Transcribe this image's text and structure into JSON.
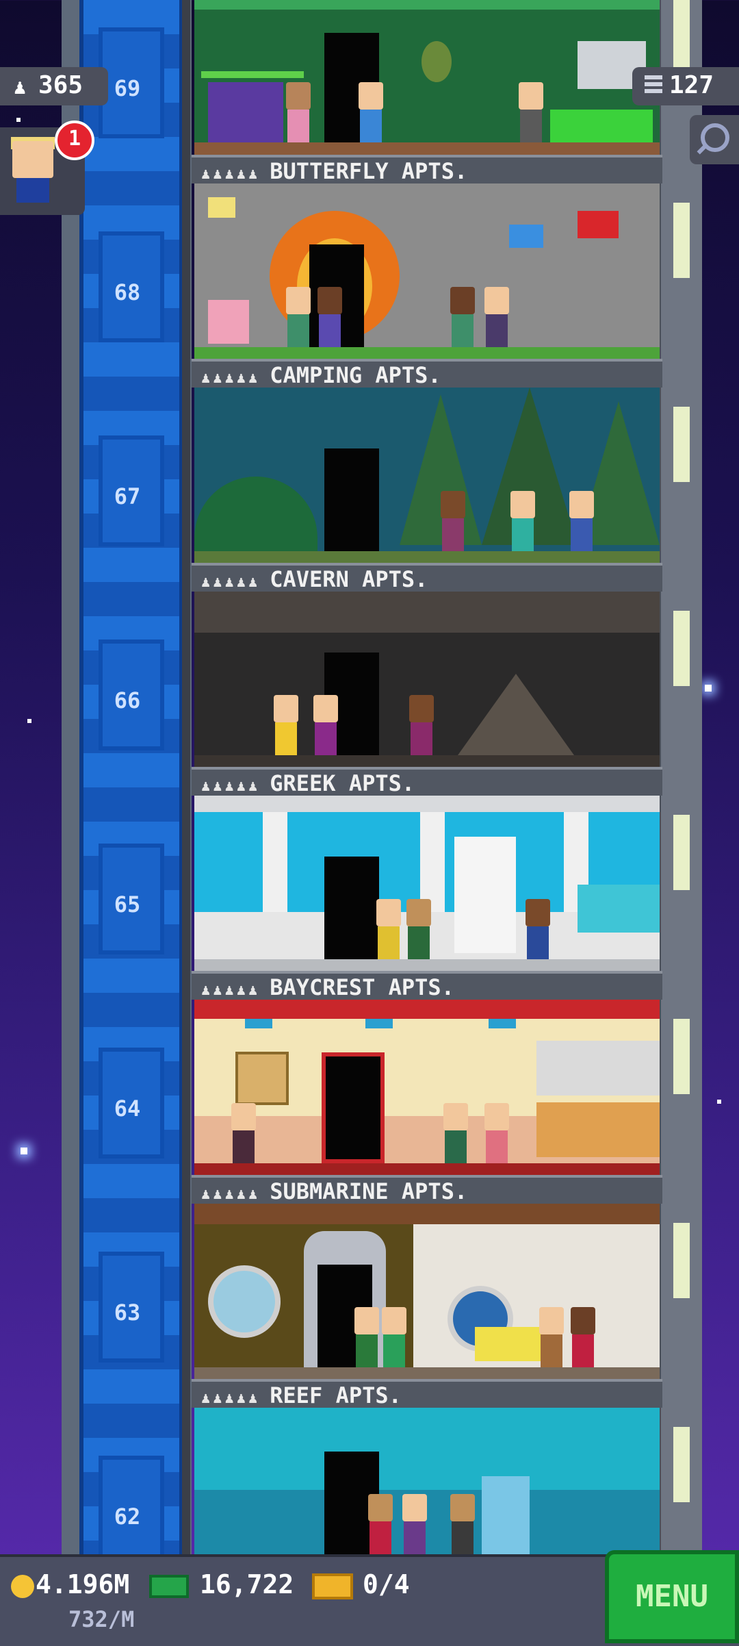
{
  "hud": {
    "population": "365",
    "floors": "127",
    "notification_count": "1"
  },
  "floors": [
    {
      "number": "69",
      "name": ""
    },
    {
      "number": "68",
      "name": "BUTTERFLY APTS."
    },
    {
      "number": "67",
      "name": "CAMPING APTS."
    },
    {
      "number": "66",
      "name": "CAVERN APTS."
    },
    {
      "number": "65",
      "name": "GREEK APTS."
    },
    {
      "number": "64",
      "name": "BAYCREST APTS."
    },
    {
      "number": "63",
      "name": "SUBMARINE APTS."
    },
    {
      "number": "62",
      "name": "REEF APTS."
    }
  ],
  "sign_stars": "♟♟♟♟♟",
  "bottom": {
    "coins": "4.196M",
    "coin_rate": "732/M",
    "bux": "16,722",
    "tickets": "0/4",
    "menu_label": "MENU"
  },
  "colors": {
    "elevator_blue": "#1f6fd6",
    "menu_green": "#1fae3f",
    "sign_gray": "#515762"
  }
}
